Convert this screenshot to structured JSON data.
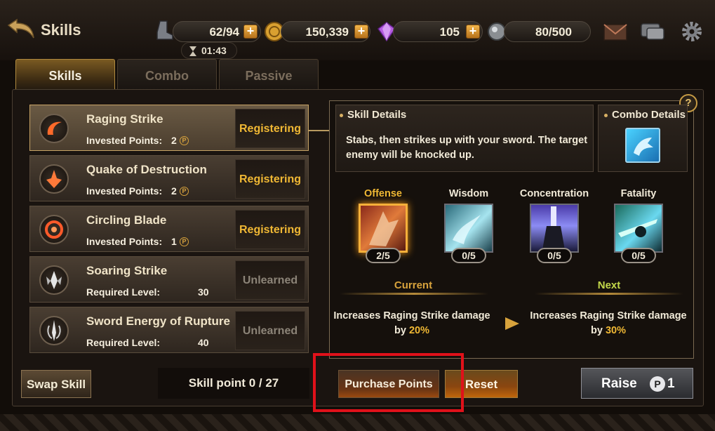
{
  "header": {
    "title": "Skills",
    "stamina": "62/94",
    "gold": "150,339",
    "gems": "105",
    "orbs": "80/500",
    "timer": "01:43"
  },
  "tabs": [
    {
      "label": "Skills",
      "active": true
    },
    {
      "label": "Combo",
      "active": false
    },
    {
      "label": "Passive",
      "active": false
    }
  ],
  "skills": [
    {
      "name": "Raging Strike",
      "sub_label": "Invested Points:",
      "sub_value": "2",
      "state": "Registering"
    },
    {
      "name": "Quake of Destruction",
      "sub_label": "Invested Points:",
      "sub_value": "2",
      "state": "Registering"
    },
    {
      "name": "Circling Blade",
      "sub_label": "Invested Points:",
      "sub_value": "1",
      "state": "Registering"
    },
    {
      "name": "Soaring Strike",
      "sub_label": "Required Level:",
      "sub_value": "30",
      "state": "Unlearned"
    },
    {
      "name": "Sword Energy of Rupture",
      "sub_label": "Required Level:",
      "sub_value": "40",
      "state": "Unlearned"
    }
  ],
  "points_badge": "P",
  "detail": {
    "skill_details_title": "Skill Details",
    "description": "Stabs, then strikes up with your sword. The target enemy will be knocked up.",
    "combo_details_title": "Combo Details",
    "help": "?",
    "branches": [
      {
        "label": "Offense",
        "count": "2/5",
        "selected": true
      },
      {
        "label": "Wisdom",
        "count": "0/5",
        "selected": false
      },
      {
        "label": "Concentration",
        "count": "0/5",
        "selected": false
      },
      {
        "label": "Fatality",
        "count": "0/5",
        "selected": false
      }
    ],
    "current_label": "Current",
    "next_label": "Next",
    "current_effect_prefix": "Increases Raging Strike damage",
    "current_effect_by": "by",
    "current_effect_value": "20%",
    "next_effect_prefix": "Increases Raging Strike damage",
    "next_effect_by": "by",
    "next_effect_value": "30%"
  },
  "footer": {
    "swap_label": "Swap Skill",
    "skill_point": "Skill point 0 / 27",
    "purchase_label": "Purchase Points",
    "reset_label": "Reset",
    "raise_label": "Raise",
    "raise_badge": "P",
    "raise_cost": "1"
  },
  "colors": {
    "accent_gold": "#f0b834",
    "next_green": "#c3d84a",
    "highlight_red": "#e0111a"
  }
}
